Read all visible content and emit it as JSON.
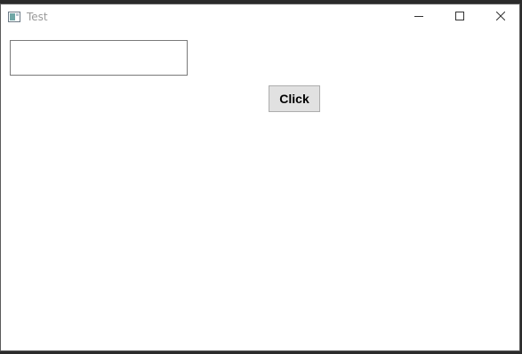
{
  "window": {
    "title": "Test",
    "controls": {
      "minimize": "minimize-icon",
      "maximize": "maximize-icon",
      "close": "close-icon"
    }
  },
  "form": {
    "text_input": {
      "value": "",
      "placeholder": ""
    },
    "button_label": "Click"
  },
  "colors": {
    "title_text": "#9a9a9a",
    "button_bg": "#e1e1e1",
    "button_border": "#adadad",
    "input_border": "#7a7a7a"
  }
}
